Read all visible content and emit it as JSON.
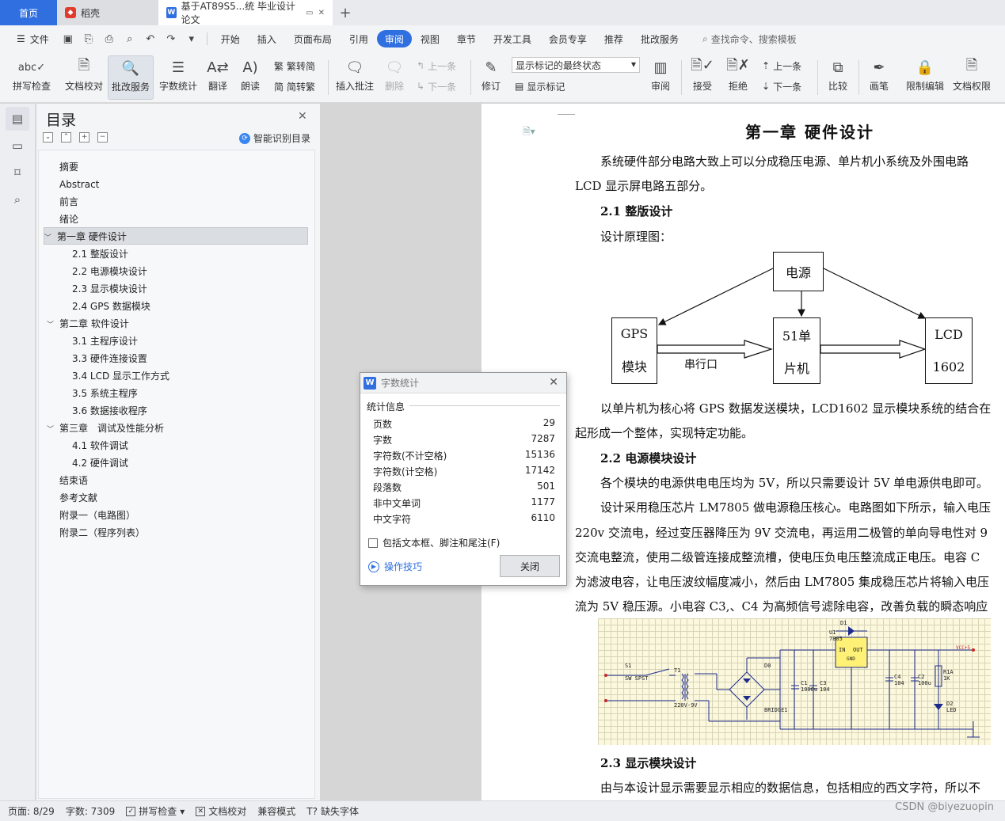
{
  "tabs": {
    "home": "首页",
    "daoke": "稻壳",
    "doc": "基于AT89S5...统 毕业设计论文",
    "plus": "+"
  },
  "menu": {
    "file": "文件",
    "items": [
      "开始",
      "插入",
      "页面布局",
      "引用",
      "审阅",
      "视图",
      "章节",
      "开发工具",
      "会员专享",
      "推荐",
      "批改服务"
    ],
    "search": "查找命令、搜索模板"
  },
  "ribbon": {
    "spellcheck": "拼写检查",
    "doccheck": "文档校对",
    "correction": "批改服务",
    "wordcount": "字数统计",
    "translate": "翻译",
    "read": "朗读",
    "trad": "繁转简",
    "simp": "简转繁",
    "insert_comment": "插入批注",
    "delete": "删除",
    "prev": "上一条",
    "next": "下一条",
    "revise": "修订",
    "markup_state": "显示标记的最终状态",
    "show_markup": "显示标记",
    "review": "审阅",
    "accept": "接受",
    "reject": "拒绝",
    "prev2": "上一条",
    "next2": "下一条",
    "compare": "比较",
    "pen": "画笔",
    "restrict": "限制编辑",
    "permission": "文档权限"
  },
  "toc": {
    "title": "目录",
    "smart": "智能识别目录",
    "items": [
      "摘要",
      "Abstract",
      "前言",
      "绪论",
      "第一章 硬件设计",
      "2.1 整版设计",
      "2.2 电源模块设计",
      "2.3 显示模块设计",
      "2.4 GPS 数据模块",
      "第二章 软件设计",
      "3.1 主程序设计",
      "3.3 硬件连接设置",
      "3.4 LCD 显示工作方式",
      "3.5 系统主程序",
      "3.6 数据接收程序",
      "第三章　调试及性能分析",
      "4.1 软件调试",
      "4.2 硬件调试",
      "结束语",
      "参考文献",
      "附录一（电路图）",
      "附录二（程序列表）"
    ]
  },
  "doc": {
    "heading": "第一章 硬件设计",
    "p1a": "系统硬件部分电路大致上可以分成稳压电源、单片机小系统及外围电路",
    "p1b": "LCD 显示屏电路五部分。",
    "h21": "2.1 整版设计",
    "p2": "设计原理图：",
    "box_power": "电源",
    "box_gps_1": "GPS",
    "box_gps_2": "模块",
    "box_mcu_1": "51单",
    "box_mcu_2": "片机",
    "box_lcd_1": "LCD",
    "box_lcd_2": "1602",
    "serial": "串行口",
    "p3a": "以单片机为核心将 GPS 数据发送模块，LCD1602 显示模块系统的结合在",
    "p3b": "起形成一个整体，实现特定功能。",
    "h22": "2.2 电源模块设计",
    "p4": "各个模块的电源供电电压均为 5V，所以只需要设计 5V 单电源供电即可。",
    "p5a": "设计采用稳压芯片 LM7805 做电源稳压核心。电路图如下所示，输入电压",
    "p5b": "220v 交流电，经过变压器降压为 9V 交流电，再运用二极管的单向导电性对 9",
    "p5c": "交流电整流，使用二级管连接成整流槽，使电压负电压整流成正电压。电容 C",
    "p5d": "为滤波电容，让电压波纹幅度减小，然后由 LM7805 集成稳压芯片将输入电压",
    "p5e": "流为 5V 稳压源。小电容 C3,、C4 为高频信号滤除电容，改善负载的瞬态响应",
    "h23": "2.3 显示模块设计",
    "p6": "由与本设计显示需要显示相应的数据信息，包括相应的西文字符，所以不",
    "circuit_labels": {
      "s1": "S1",
      "sw": "SW SPST",
      "t1": "T1",
      "v220": "220V-9V",
      "d0": "D0",
      "bridge": "BRIDGE1",
      "u1": "U1",
      "chip": "7805",
      "in": "IN",
      "out": "OUT",
      "gnd": "GND",
      "d1": "D1",
      "c1": "C1",
      "c1v": "1000u",
      "c3": "C3",
      "c3v": "104",
      "c4": "C4",
      "c4v": "104",
      "c2": "C2",
      "c2v": "100u",
      "r1a": "R1A",
      "r1v": "1K",
      "d2": "D2",
      "led": "LED",
      "vcc": "VCC+5"
    }
  },
  "dialog": {
    "title": "字数统计",
    "section": "统计信息",
    "rows": [
      {
        "label": "页数",
        "value": "29"
      },
      {
        "label": "字数",
        "value": "7287"
      },
      {
        "label": "字符数(不计空格)",
        "value": "15136"
      },
      {
        "label": "字符数(计空格)",
        "value": "17142"
      },
      {
        "label": "段落数",
        "value": "501"
      },
      {
        "label": "非中文单词",
        "value": "1177"
      },
      {
        "label": "中文字符",
        "value": "6110"
      }
    ],
    "checkbox": "包括文本框、脚注和尾注(F)",
    "tips": "操作技巧",
    "close": "关闭"
  },
  "status": {
    "page": "页面: 8/29",
    "words": "字数: 7309",
    "spell": "拼写检查",
    "doccheck": "文档校对",
    "compat": "兼容模式",
    "missing_font": "缺失字体"
  },
  "watermark": "CSDN @biyezuopin",
  "colors": {
    "accent": "#2f6fe0",
    "home_tab": "#2f6fe0"
  }
}
